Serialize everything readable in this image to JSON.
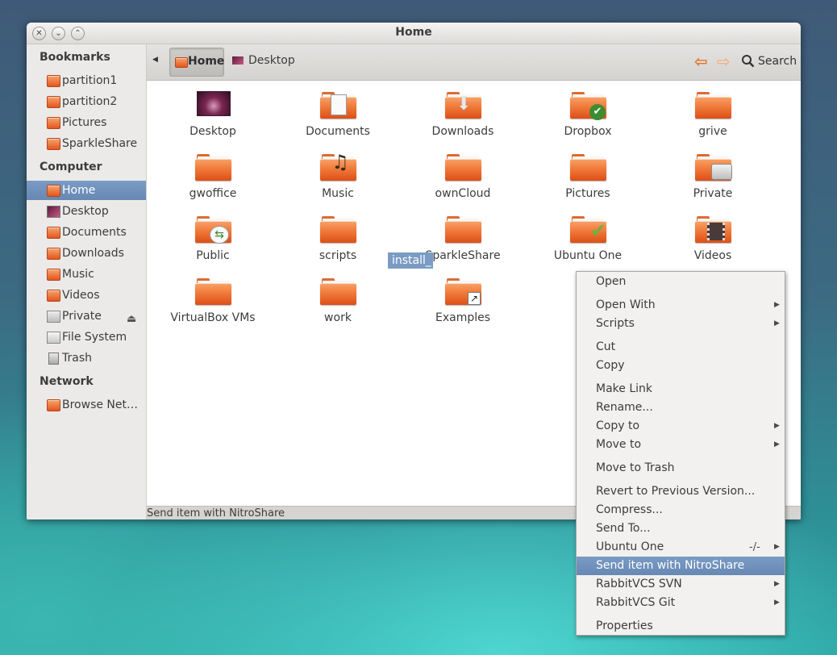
{
  "window": {
    "title": "Home"
  },
  "sidebar": {
    "headers": {
      "bookmarks": "Bookmarks",
      "computer": "Computer",
      "network": "Network"
    },
    "bookmarks": [
      "partition1",
      "partition2",
      "Pictures",
      "SparkleShare"
    ],
    "computer": [
      "Home",
      "Desktop",
      "Documents",
      "Downloads",
      "Music",
      "Videos",
      "Private",
      "File System",
      "Trash"
    ],
    "network": [
      "Browse Net…"
    ]
  },
  "toolbar": {
    "breadcrumb": [
      "Home",
      "Desktop"
    ],
    "search_label": "Search"
  },
  "files": [
    {
      "name": "Desktop",
      "icon": "desktop-wallpaper"
    },
    {
      "name": "Documents",
      "icon": "folder-documents"
    },
    {
      "name": "Downloads",
      "icon": "folder-downloads"
    },
    {
      "name": "Dropbox",
      "icon": "folder-dropbox"
    },
    {
      "name": "grive",
      "icon": "folder"
    },
    {
      "name": "gwoffice",
      "icon": "folder"
    },
    {
      "name": "Music",
      "icon": "folder-music"
    },
    {
      "name": "ownCloud",
      "icon": "folder"
    },
    {
      "name": "Pictures",
      "icon": "folder"
    },
    {
      "name": "Private",
      "icon": "folder-private"
    },
    {
      "name": "Public",
      "icon": "folder-public"
    },
    {
      "name": "scripts",
      "icon": "folder"
    },
    {
      "name": "SparkleShare",
      "icon": "folder"
    },
    {
      "name": "Ubuntu One",
      "icon": "folder-ubuntu-one"
    },
    {
      "name": "Videos",
      "icon": "folder-videos"
    },
    {
      "name": "VirtualBox VMs",
      "icon": "folder"
    },
    {
      "name": "work",
      "icon": "folder"
    },
    {
      "name": "Examples",
      "icon": "folder-link"
    }
  ],
  "selected_file": {
    "name_visible": "install_"
  },
  "statusbar": {
    "text": "Send item with NitroShare"
  },
  "context_menu": {
    "items": [
      {
        "label": "Open"
      },
      {
        "label": "Open With",
        "submenu": true
      },
      {
        "label": "Scripts",
        "submenu": true
      },
      {
        "label": "Cut"
      },
      {
        "label": "Copy"
      },
      {
        "label": "Make Link"
      },
      {
        "label": "Rename..."
      },
      {
        "label": "Copy to",
        "submenu": true
      },
      {
        "label": "Move to",
        "submenu": true
      },
      {
        "label": "Move to Trash"
      },
      {
        "label": "Revert to Previous Version..."
      },
      {
        "label": "Compress..."
      },
      {
        "label": "Send To..."
      },
      {
        "label": "Ubuntu One",
        "accel": "-/-",
        "submenu": true
      },
      {
        "label": "Send item with NitroShare",
        "highlighted": true
      },
      {
        "label": "RabbitVCS SVN",
        "submenu": true
      },
      {
        "label": "RabbitVCS Git",
        "submenu": true
      },
      {
        "label": "Properties"
      }
    ]
  },
  "colors": {
    "selection": "#7a9bc4",
    "folder": "#f07a3a",
    "accent_back": "#e3742a"
  }
}
